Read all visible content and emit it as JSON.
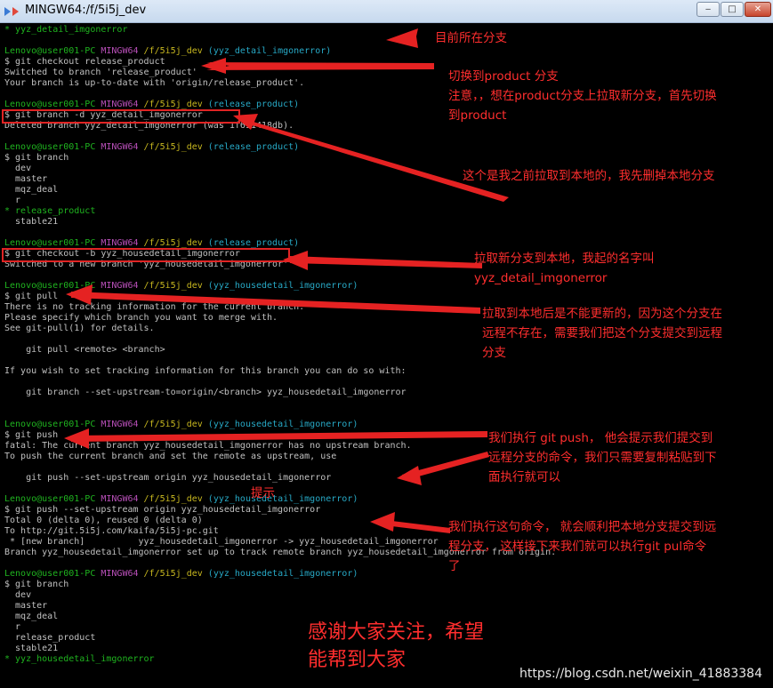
{
  "window": {
    "title": "MINGW64:/f/5i5j_dev",
    "minimize": "‒",
    "maximize": "□",
    "close": "✕"
  },
  "terminal": {
    "lines": [
      {
        "segs": [
          [
            "cur",
            "* "
          ],
          [
            "cur",
            "yyz_detail_imgonerror"
          ]
        ]
      },
      {
        "segs": []
      },
      {
        "segs": [
          [
            "user",
            "Lenovo@user001-PC "
          ],
          [
            "host",
            "MINGW64 "
          ],
          [
            "path",
            "/f/5i5j_dev "
          ],
          [
            "branch",
            "(yyz_detail_imgonerror)"
          ]
        ]
      },
      {
        "segs": [
          [
            "",
            "$ git checkout release_product"
          ]
        ]
      },
      {
        "segs": [
          [
            "",
            "Switched to branch 'release_product'"
          ]
        ]
      },
      {
        "segs": [
          [
            "",
            "Your branch is up-to-date with 'origin/release_product'."
          ]
        ]
      },
      {
        "segs": []
      },
      {
        "segs": [
          [
            "user",
            "Lenovo@user001-PC "
          ],
          [
            "host",
            "MINGW64 "
          ],
          [
            "path",
            "/f/5i5j_dev "
          ],
          [
            "branch",
            "(release_product)"
          ]
        ]
      },
      {
        "segs": [
          [
            "",
            "$ git branch -d yyz_detail_imgonerror"
          ]
        ]
      },
      {
        "segs": [
          [
            "",
            "Deleted branch yyz_detail_imgonerror (was 1f691418db)."
          ]
        ]
      },
      {
        "segs": []
      },
      {
        "segs": [
          [
            "user",
            "Lenovo@user001-PC "
          ],
          [
            "host",
            "MINGW64 "
          ],
          [
            "path",
            "/f/5i5j_dev "
          ],
          [
            "branch",
            "(release_product)"
          ]
        ]
      },
      {
        "segs": [
          [
            "",
            "$ git branch"
          ]
        ]
      },
      {
        "segs": [
          [
            "",
            "  dev"
          ]
        ]
      },
      {
        "segs": [
          [
            "",
            "  master"
          ]
        ]
      },
      {
        "segs": [
          [
            "",
            "  mqz_deal"
          ]
        ]
      },
      {
        "segs": [
          [
            "",
            "  r"
          ]
        ]
      },
      {
        "segs": [
          [
            "cur",
            "* release_product"
          ]
        ]
      },
      {
        "segs": [
          [
            "",
            "  stable21"
          ]
        ]
      },
      {
        "segs": []
      },
      {
        "segs": [
          [
            "user",
            "Lenovo@user001-PC "
          ],
          [
            "host",
            "MINGW64 "
          ],
          [
            "path",
            "/f/5i5j_dev "
          ],
          [
            "branch",
            "(release_product)"
          ]
        ]
      },
      {
        "segs": [
          [
            "",
            "$ git checkout -b yyz_housedetail_imgonerror"
          ]
        ]
      },
      {
        "segs": [
          [
            "",
            "Switched to a new branch 'yyz_housedetail_imgonerror'"
          ]
        ]
      },
      {
        "segs": []
      },
      {
        "segs": [
          [
            "user",
            "Lenovo@user001-PC "
          ],
          [
            "host",
            "MINGW64 "
          ],
          [
            "path",
            "/f/5i5j_dev "
          ],
          [
            "branch",
            "(yyz_housedetail_imgonerror)"
          ]
        ]
      },
      {
        "segs": [
          [
            "",
            "$ git pull"
          ]
        ]
      },
      {
        "segs": [
          [
            "",
            "There is no tracking information for the current branch."
          ]
        ]
      },
      {
        "segs": [
          [
            "",
            "Please specify which branch you want to merge with."
          ]
        ]
      },
      {
        "segs": [
          [
            "",
            "See git-pull(1) for details."
          ]
        ]
      },
      {
        "segs": []
      },
      {
        "segs": [
          [
            "",
            "    git pull <remote> <branch>"
          ]
        ]
      },
      {
        "segs": []
      },
      {
        "segs": [
          [
            "",
            "If you wish to set tracking information for this branch you can do so with:"
          ]
        ]
      },
      {
        "segs": []
      },
      {
        "segs": [
          [
            "",
            "    git branch --set-upstream-to=origin/<branch> yyz_housedetail_imgonerror"
          ]
        ]
      },
      {
        "segs": []
      },
      {
        "segs": []
      },
      {
        "segs": [
          [
            "user",
            "Lenovo@user001-PC "
          ],
          [
            "host",
            "MINGW64 "
          ],
          [
            "path",
            "/f/5i5j_dev "
          ],
          [
            "branch",
            "(yyz_housedetail_imgonerror)"
          ]
        ]
      },
      {
        "segs": [
          [
            "",
            "$ git push"
          ]
        ]
      },
      {
        "segs": [
          [
            "",
            "fatal: The current branch yyz_housedetail_imgonerror has no upstream branch."
          ]
        ]
      },
      {
        "segs": [
          [
            "",
            "To push the current branch and set the remote as upstream, use"
          ]
        ]
      },
      {
        "segs": []
      },
      {
        "segs": [
          [
            "",
            "    git push --set-upstream origin yyz_housedetail_imgonerror"
          ]
        ]
      },
      {
        "segs": []
      },
      {
        "segs": [
          [
            "user",
            "Lenovo@user001-PC "
          ],
          [
            "host",
            "MINGW64 "
          ],
          [
            "path",
            "/f/5i5j_dev "
          ],
          [
            "branch",
            "(yyz_housedetail_imgonerror)"
          ]
        ]
      },
      {
        "segs": [
          [
            "",
            "$ git push --set-upstream origin yyz_housedetail_imgonerror"
          ]
        ]
      },
      {
        "segs": [
          [
            "",
            "Total 0 (delta 0), reused 0 (delta 0)"
          ]
        ]
      },
      {
        "segs": [
          [
            "",
            "To http://git.5i5j.com/kaifa/5i5j-pc.git"
          ]
        ]
      },
      {
        "segs": [
          [
            "",
            " * [new branch]          yyz_housedetail_imgonerror -> yyz_housedetail_imgonerror"
          ]
        ]
      },
      {
        "segs": [
          [
            "",
            "Branch yyz_housedetail_imgonerror set up to track remote branch yyz_housedetail_imgonerror from origin."
          ]
        ]
      },
      {
        "segs": []
      },
      {
        "segs": [
          [
            "user",
            "Lenovo@user001-PC "
          ],
          [
            "host",
            "MINGW64 "
          ],
          [
            "path",
            "/f/5i5j_dev "
          ],
          [
            "branch",
            "(yyz_housedetail_imgonerror)"
          ]
        ]
      },
      {
        "segs": [
          [
            "",
            "$ git branch"
          ]
        ]
      },
      {
        "segs": [
          [
            "",
            "  dev"
          ]
        ]
      },
      {
        "segs": [
          [
            "",
            "  master"
          ]
        ]
      },
      {
        "segs": [
          [
            "",
            "  mqz_deal"
          ]
        ]
      },
      {
        "segs": [
          [
            "",
            "  r"
          ]
        ]
      },
      {
        "segs": [
          [
            "",
            "  release_product"
          ]
        ]
      },
      {
        "segs": [
          [
            "",
            "  stable21"
          ]
        ]
      },
      {
        "segs": [
          [
            "cur",
            "* yyz_housedetail_imgonerror"
          ]
        ]
      }
    ]
  },
  "annotations": {
    "current_branch": "目前所在分支",
    "switch_line1": "切换到product 分支",
    "switch_line2": "注意，，想在product分支上拉取新分支，首先切换",
    "switch_line3": "到product",
    "delete_local": "这个是我之前拉取到本地的，我先删掉本地分支",
    "new_branch_line1": "拉取新分支到本地，我起的名字叫",
    "new_branch_line2": "yyz_detail_imgonerror",
    "pull_line1": "拉取到本地后是不能更新的，因为这个分支在",
    "pull_line2": "远程不存在，需要我们把这个分支提交到远程",
    "pull_line3": "分支",
    "push_line1": "我们执行 git push， 他会提示我们提交到",
    "push_line2": "远程分支的命令，我们只需要复制粘贴到下",
    "push_line3": "面执行就可以",
    "hint": "提示",
    "result_line1": "我们执行这句命令， 就会顺利把本地分支提交到远",
    "result_line2": "程分支，  这样接下来我们就可以执行git pul命令",
    "result_line3": "了",
    "thanks_line1": "感谢大家关注，希望",
    "thanks_line2": "能帮到大家"
  },
  "watermark": "https://blog.csdn.net/weixin_41883384",
  "colors": {
    "terminal_bg": "#000000",
    "terminal_text": "#c0c0c0",
    "prompt_user": "#1fb31f",
    "prompt_host": "#b84fb8",
    "prompt_path": "#c8b81f",
    "prompt_branch": "#27a9c6",
    "annotation_red": "#ff2e2e"
  }
}
